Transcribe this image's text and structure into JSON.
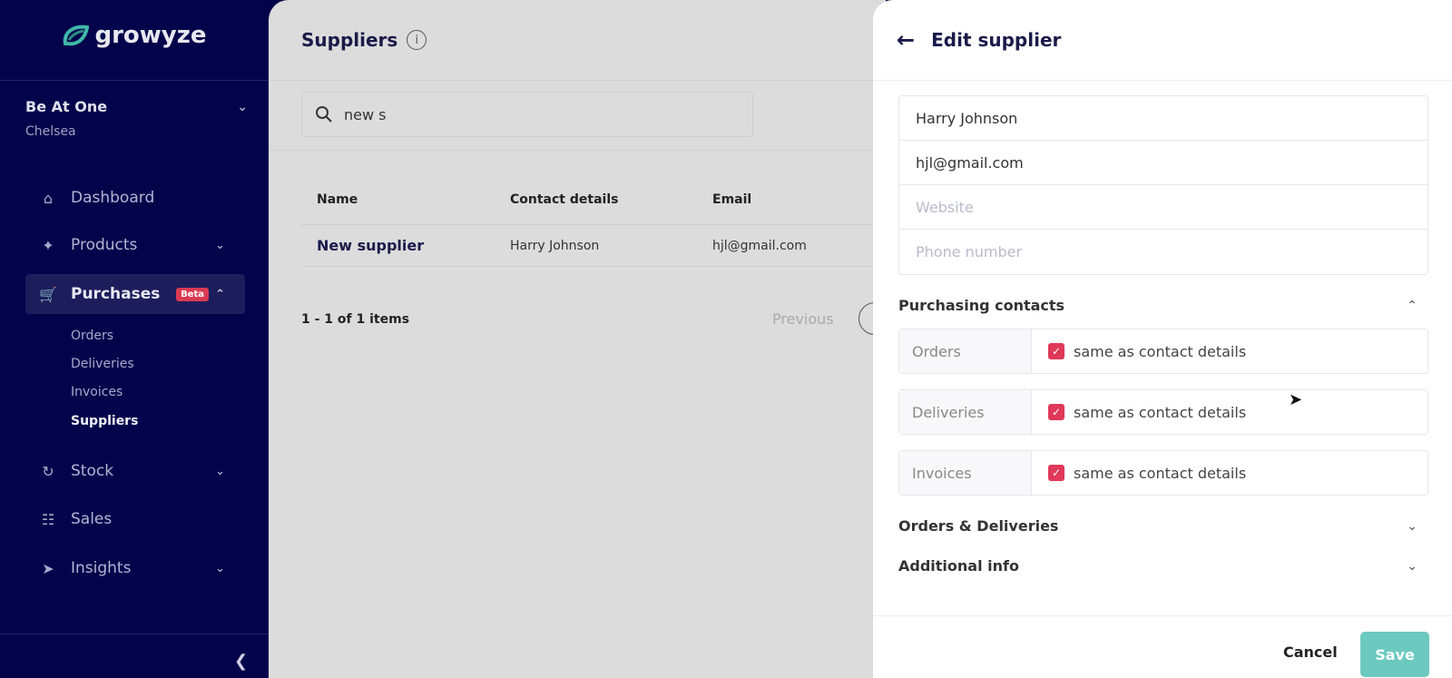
{
  "brand": {
    "name": "growyze",
    "logo_color": "#3fb8a8"
  },
  "org": {
    "name": "Be At One",
    "location": "Chelsea"
  },
  "nav": [
    {
      "label": "Dashboard",
      "icon": "home-icon"
    },
    {
      "label": "Products",
      "icon": "bottle-icon"
    },
    {
      "label": "Purchases",
      "icon": "cart-icon",
      "badge": "Beta"
    },
    {
      "label": "Stock",
      "icon": "refresh-icon"
    },
    {
      "label": "Sales",
      "icon": "coins-icon"
    },
    {
      "label": "Insights",
      "icon": "rocket-icon"
    }
  ],
  "purchases_sub": [
    "Orders",
    "Deliveries",
    "Invoices",
    "Suppliers"
  ],
  "main": {
    "title": "Suppliers",
    "search_value": "new s",
    "columns": [
      "Name",
      "Contact details",
      "Email"
    ],
    "rows": [
      {
        "name": "New supplier",
        "contact": "Harry Johnson",
        "email": "hjl@gmail.com"
      }
    ],
    "pagination": "1 - 1 of 1 items",
    "previous": "Previous"
  },
  "panel": {
    "title": "Edit supplier",
    "contact_name": "Harry Johnson",
    "email": "hjl@gmail.com",
    "website_placeholder": "Website",
    "phone_placeholder": "Phone number",
    "purchasing_contacts": "Purchasing contacts",
    "contacts": [
      {
        "label": "Orders",
        "checkbox": "same as contact details",
        "checked": true
      },
      {
        "label": "Deliveries",
        "checkbox": "same as contact details",
        "checked": true
      },
      {
        "label": "Invoices",
        "checkbox": "same as contact details",
        "checked": true
      }
    ],
    "orders_deliveries": "Orders & Deliveries",
    "additional_info": "Additional info",
    "cancel": "Cancel",
    "save": "Save"
  },
  "colors": {
    "sidebar": "#03034b",
    "accent_red": "#e0395a",
    "save_teal": "#6cc9c0"
  }
}
